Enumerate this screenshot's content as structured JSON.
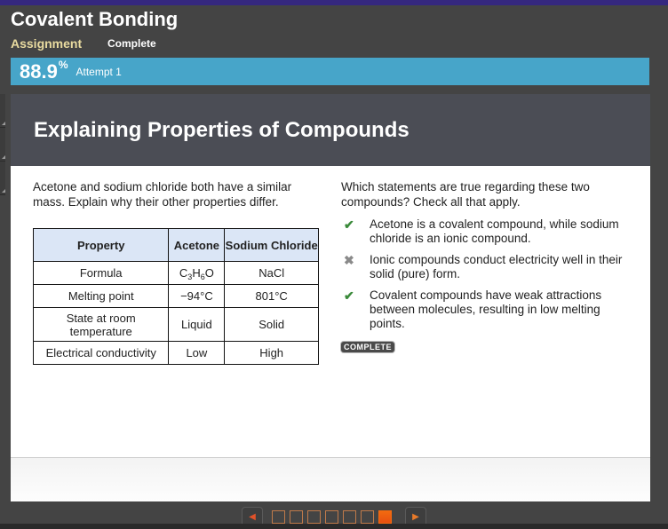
{
  "header": {
    "title": "Covalent Bonding",
    "assignment_label": "Assignment",
    "status": "Complete"
  },
  "score": {
    "value": "88.9",
    "percent_sign": "%",
    "attempt": "Attempt 1"
  },
  "panel": {
    "title": "Explaining Properties of Compounds",
    "prompt": "Acetone and sodium chloride both have a similar mass. Explain why their other properties differ."
  },
  "table": {
    "headers": [
      "Property",
      "Acetone",
      "Sodium Chloride"
    ],
    "rows": [
      {
        "property": "Formula",
        "acetone": "C3H6O",
        "nacl": "NaCl"
      },
      {
        "property": "Melting point",
        "acetone": "−94°C",
        "nacl": "801°C"
      },
      {
        "property": "State at room temperature",
        "acetone": "Liquid",
        "nacl": "Solid"
      },
      {
        "property": "Electrical conductivity",
        "acetone": "Low",
        "nacl": "High"
      }
    ],
    "formula_parts": {
      "c": "C",
      "c_sub": "3",
      "h": "H",
      "h_sub": "6",
      "o": "O"
    }
  },
  "question": {
    "text": "Which statements are true regarding these two compounds? Check all that apply.",
    "options": [
      {
        "text": "Acetone is a covalent compound, while sodium chloride is an ionic compound.",
        "mark": "correct",
        "icon": "✔"
      },
      {
        "text": "Ionic compounds conduct electricity well in their solid (pure) form.",
        "mark": "wrong",
        "icon": "✖"
      },
      {
        "text": "Covalent compounds have weak attractions between molecules, resulting in low melting points.",
        "mark": "correct",
        "icon": "✔"
      }
    ],
    "badge": "COMPLETE"
  },
  "nav": {
    "prev_icon": "◀",
    "next_icon": "▶",
    "page_count": 7,
    "current_page": 7
  },
  "colors": {
    "accent_bar": "#47a5c9",
    "top_strip": "#35287f",
    "active_page": "#f26a10",
    "correct": "#3a8a3a"
  }
}
